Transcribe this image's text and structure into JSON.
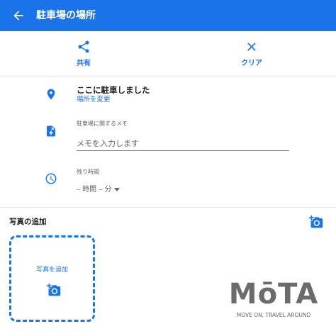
{
  "appbar": {
    "title": "駐車場の場所",
    "back_icon": "arrow-back-icon"
  },
  "actions": {
    "share_label": "共有",
    "clear_label": "クリア"
  },
  "location": {
    "title": "ここに駐車しました",
    "change_link": "場所を変更"
  },
  "memo": {
    "label": "駐車場に関するメモ",
    "placeholder": "メモを入力します"
  },
  "time_remaining": {
    "label": "残り時間",
    "value": "– 時間 – 分"
  },
  "photos": {
    "heading": "写真の追加",
    "add_label": "写真を追加"
  },
  "brand": {
    "logo": "MōTA",
    "tagline": "MOVE ON, TRAVEL AROUND"
  },
  "colors": {
    "accent": "#1a73e8",
    "text": "#202124",
    "secondary_text": "#5f6368",
    "divider": "#e8eaed",
    "brand_gray": "#6b6b6b"
  }
}
